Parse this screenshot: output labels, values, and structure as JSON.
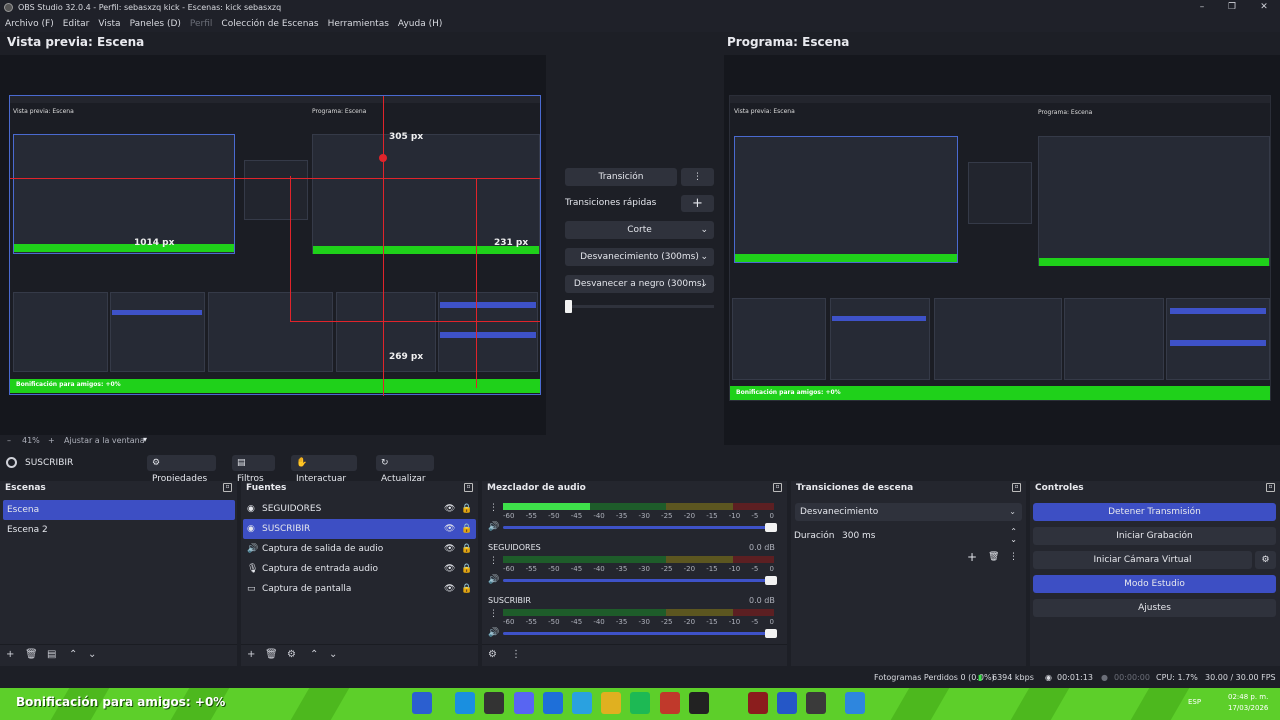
{
  "window": {
    "title": "OBS Studio 32.0.4 - Perfil: sebasxzq kick - Escenas: kick sebasxzq",
    "controls": [
      "–",
      "❐",
      "✕"
    ]
  },
  "menu": [
    "Archivo (F)",
    "Editar",
    "Vista",
    "Paneles (D)",
    "Perfil",
    "Colección de Escenas",
    "Herramientas",
    "Ayuda (H)"
  ],
  "preview": {
    "title": "Vista previa: Escena",
    "zoom_minus": "–",
    "zoom": "41%",
    "zoom_plus": "+",
    "fit": "Ajustar a la ventana",
    "fit_arrow": "▾",
    "measures": [
      "305 px",
      "1014 px",
      "231 px",
      "269 px"
    ],
    "nested_titles": [
      "Vista previa: Escena",
      "Programa: Escena"
    ],
    "nested_banner": "Bonificación para amigos: +0%"
  },
  "program": {
    "title": "Programa: Escena",
    "nested_titles": [
      "Vista previa: Escena",
      "Programa: Escena"
    ],
    "nested_banner": "Bonificación para amigos: +0%"
  },
  "transitions_mid": {
    "transition_button": "Transición",
    "menu_icon": "⋮",
    "quick_label": "Transiciones rápidas",
    "add_icon": "+",
    "options": [
      "Corte",
      "Desvanecimiento (300ms)",
      "Desvanecer a negro (300ms)"
    ],
    "caret": "⌄"
  },
  "source_toolbar": {
    "selected": "SUSCRIBIR",
    "properties": "Propiedades",
    "filters": "Filtros",
    "interact": "Interactuar",
    "refresh": "Actualizar"
  },
  "scenes": {
    "title": "Escenas",
    "items": [
      "Escena",
      "Escena 2"
    ]
  },
  "sources": {
    "title": "Fuentes",
    "items": [
      "SEGUIDORES",
      "SUSCRIBIR",
      "Captura de salida de audio",
      "Captura de entrada audio",
      "Captura de pantalla"
    ]
  },
  "mixer": {
    "title": "Mezclador de audio",
    "scale": [
      "-60",
      "-55",
      "-50",
      "-45",
      "-40",
      "-35",
      "-30",
      "-25",
      "-20",
      "-15",
      "-10",
      "-5",
      "0"
    ],
    "channels": [
      {
        "name": "",
        "db": "",
        "level": 0.32
      },
      {
        "name": "SEGUIDORES",
        "db": "0.0 dB",
        "level": 0.0
      },
      {
        "name": "SUSCRIBIR",
        "db": "0.0 dB",
        "level": 0.0
      }
    ]
  },
  "scene_transitions": {
    "title": "Transiciones de escena",
    "selected": "Desvanecimiento",
    "duration_label": "Duración",
    "duration_value": "300 ms"
  },
  "controls": {
    "title": "Controles",
    "stop_stream": "Detener Transmisión",
    "start_recording": "Iniciar Grabación",
    "start_vcam": "Iniciar Cámara Virtual",
    "studio_mode": "Modo Estudio",
    "settings": "Ajustes"
  },
  "status": {
    "dropped": "Fotogramas Perdidos 0 (0.0%)",
    "bitrate": "6394 kbps",
    "stream_time": "00:01:13",
    "rec_time": "00:00:00",
    "cpu": "CPU: 1.7%",
    "fps": "30.00 / 30.00 FPS"
  },
  "taskbar": {
    "banner": "Bonificación para amigos: +0%",
    "lang": "ESP",
    "time": "02:48 p. m.",
    "date": "17/03/2026"
  },
  "colors": {
    "accent": "#3d4fc4",
    "background": "#1d1f26",
    "dock": "#24262e",
    "green_banner": "#1fd11a",
    "guide_red": "#e0242b"
  }
}
